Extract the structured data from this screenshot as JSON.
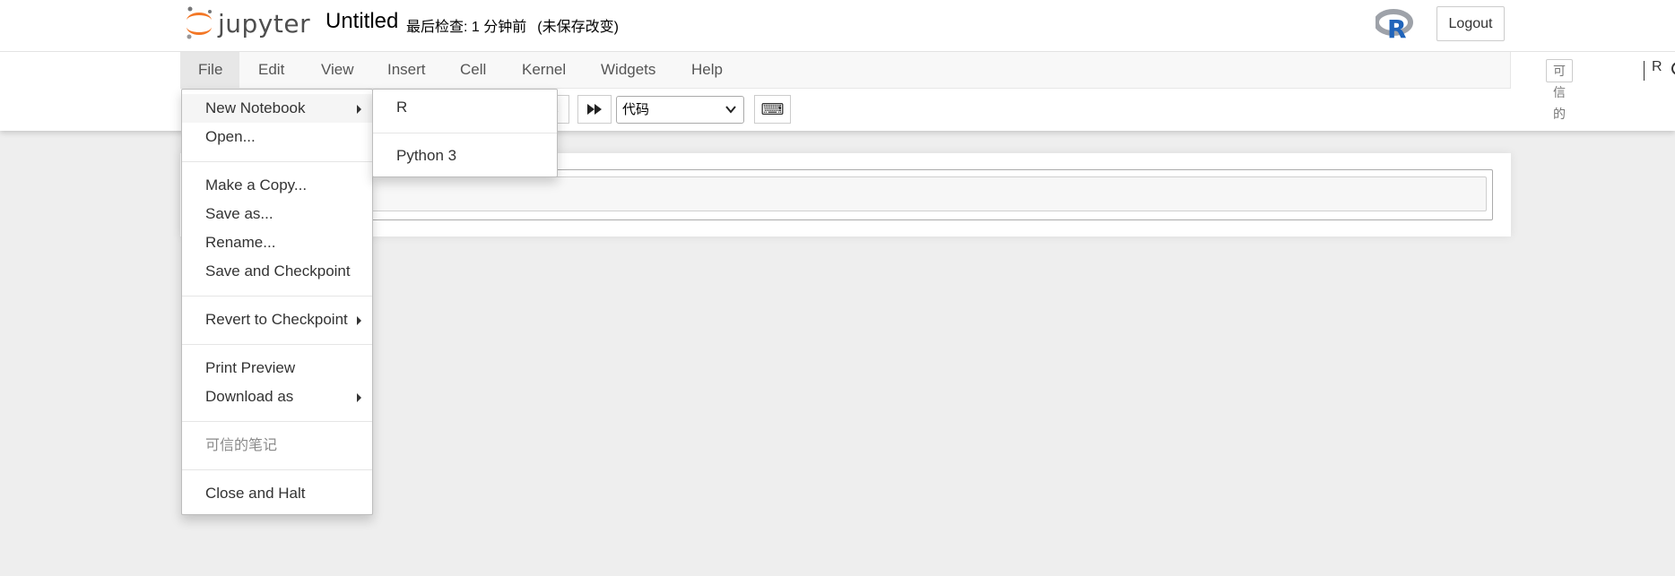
{
  "header": {
    "logo_text": "jupyter",
    "notebook_title": "Untitled",
    "checkpoint_text": "最后检查: 1 分钟前",
    "unsaved_text": "(未保存改变)",
    "logout_label": "Logout"
  },
  "menubar": {
    "items": [
      {
        "label": "File"
      },
      {
        "label": "Edit"
      },
      {
        "label": "View"
      },
      {
        "label": "Insert"
      },
      {
        "label": "Cell"
      },
      {
        "label": "Kernel"
      },
      {
        "label": "Widgets"
      },
      {
        "label": "Help"
      }
    ],
    "trusted_label": "可信的",
    "kernel_name": "R"
  },
  "toolbar": {
    "cell_type_value": "代码",
    "keyboard_icon": "⌨"
  },
  "file_menu": {
    "new_notebook": "New Notebook",
    "open": "Open...",
    "make_copy": "Make a Copy...",
    "save_as": "Save as...",
    "rename": "Rename...",
    "save_checkpoint": "Save and Checkpoint",
    "revert": "Revert to Checkpoint",
    "print_preview": "Print Preview",
    "download_as": "Download as",
    "trusted_notebook": "可信的笔记",
    "close_halt": "Close and Halt"
  },
  "new_notebook_menu": {
    "items": [
      {
        "label": "R"
      },
      {
        "label": "Python 3"
      }
    ]
  },
  "colors": {
    "jupyter_orange": "#f37726",
    "r_logo_gray": "#9ea2a9",
    "r_logo_blue": "#2064ba"
  }
}
